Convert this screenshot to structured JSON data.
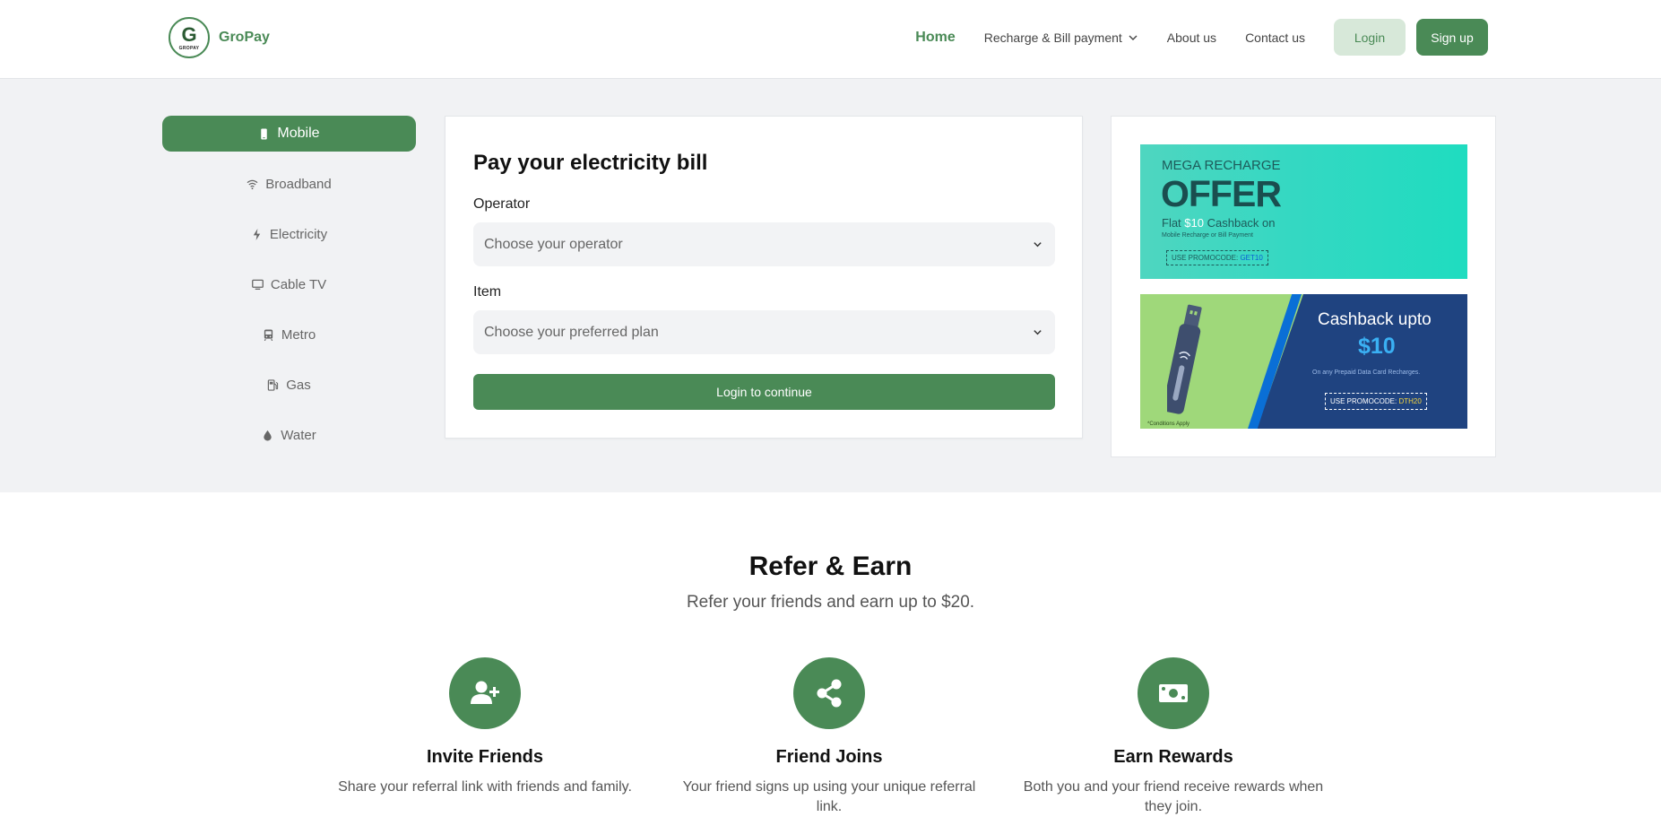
{
  "brand": {
    "name": "GroPay",
    "logo_letter": "G",
    "logo_text": "GROPAY"
  },
  "nav": {
    "home": "Home",
    "recharge": "Recharge & Bill payment",
    "about": "About us",
    "contact": "Contact us",
    "login": "Login",
    "signup": "Sign up"
  },
  "sidebar": {
    "items": [
      {
        "label": "Mobile",
        "icon": "mobile-icon"
      },
      {
        "label": "Broadband",
        "icon": "wifi-icon"
      },
      {
        "label": "Electricity",
        "icon": "bolt-icon"
      },
      {
        "label": "Cable TV",
        "icon": "tv-icon"
      },
      {
        "label": "Metro",
        "icon": "train-icon"
      },
      {
        "label": "Gas",
        "icon": "gas-pump-icon"
      },
      {
        "label": "Water",
        "icon": "droplet-icon"
      }
    ]
  },
  "pay": {
    "title": "Pay your electricity bill",
    "operator_label": "Operator",
    "operator_placeholder": "Choose your operator",
    "item_label": "Item",
    "item_placeholder": "Choose your preferred plan",
    "continue": "Login to continue"
  },
  "promo1": {
    "line1": "MEGA RECHARGE",
    "offer": "OFFER",
    "flat_prefix": "Flat ",
    "flat_amount": "$10",
    "flat_suffix": " Cashback on",
    "sub": "Mobile Recharge or Bill Payment",
    "code_prefix": "USE PROMOCODE: ",
    "code": "GET10"
  },
  "promo2": {
    "line1": "Cashback upto",
    "amount": "$10",
    "sub": "On any Prepaid Data Card Recharges.",
    "code_prefix": "USE PROMOCODE: ",
    "code": "DTH20",
    "conditions": "*Conditions Apply"
  },
  "refer": {
    "title": "Refer & Earn",
    "subtitle": "Refer your friends and earn up to $20.",
    "steps": [
      {
        "title": "Invite Friends",
        "desc": "Share your referral link with friends and family.",
        "icon": "user-plus-icon"
      },
      {
        "title": "Friend Joins",
        "desc": "Your friend signs up using your unique referral link.",
        "icon": "share-icon"
      },
      {
        "title": "Earn Rewards",
        "desc": "Both you and your friend receive rewards when they join.",
        "icon": "money-bill-icon"
      }
    ]
  },
  "colors": {
    "primary": "#4a8a56",
    "primary_light": "#d7e8d9",
    "section_bg": "#f1f2f4"
  }
}
